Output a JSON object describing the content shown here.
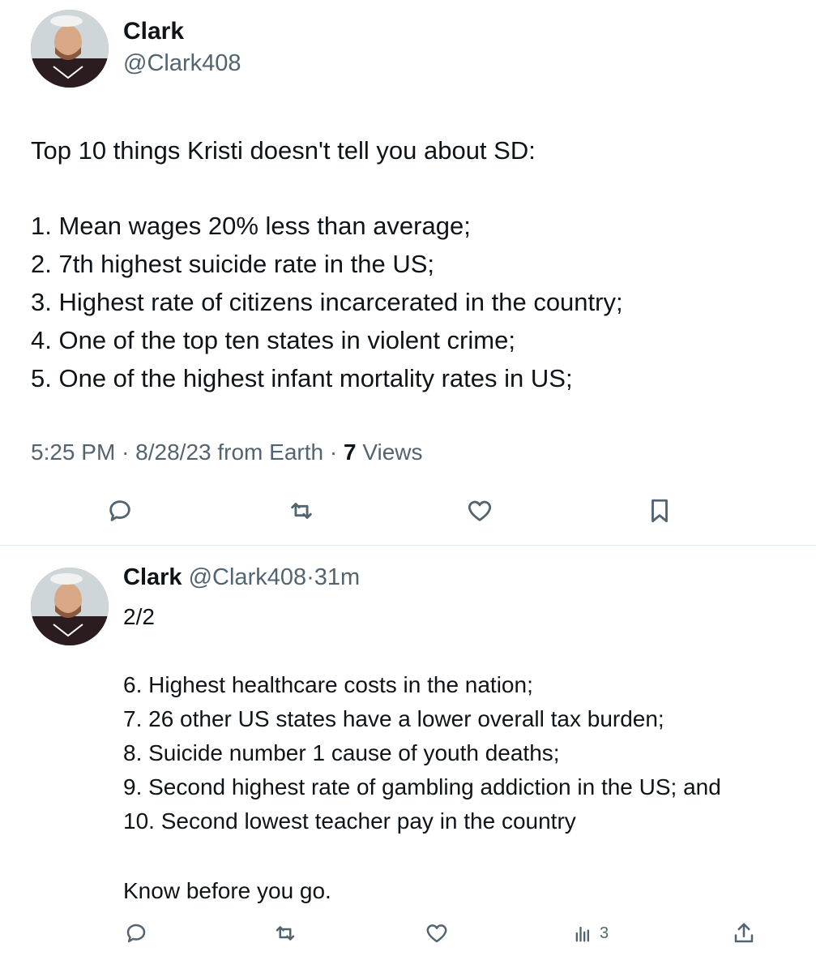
{
  "main_tweet": {
    "author_name": "Clark",
    "author_handle": "@Clark408",
    "intro": "Top 10 things Kristi doesn't tell you about SD:",
    "items": [
      "1. Mean wages 20% less than average;",
      "2. 7th highest suicide rate in the US;",
      "3. Highest rate of citizens incarcerated in the country;",
      "4. One of the top ten states in violent crime;",
      "5. One of the highest infant mortality rates in US;"
    ],
    "time": "5:25 PM",
    "date": "8/28/23",
    "source": "from Earth",
    "views_count": "7",
    "views_label": "Views"
  },
  "reply_tweet": {
    "author_name": "Clark",
    "author_handle": "@Clark408",
    "time_ago": "31m",
    "first_line": "2/2",
    "items": [
      "6. Highest healthcare costs in the nation;",
      "7. 26 other US states have a lower overall tax burden;",
      "8. Suicide number 1 cause of youth deaths;",
      "9. Second highest rate of gambling addiction in the US; and",
      "10. Second lowest teacher pay in the country"
    ],
    "closing": "Know before you go.",
    "views_count": "3"
  },
  "icons": {
    "reply": "reply-icon",
    "repost": "repost-icon",
    "like": "heart-icon",
    "bookmark": "bookmark-icon",
    "views": "views-chart-icon",
    "share": "share-icon"
  },
  "colors": {
    "text": "#0f1419",
    "secondary": "#536471",
    "divider": "#e1e8ed"
  }
}
